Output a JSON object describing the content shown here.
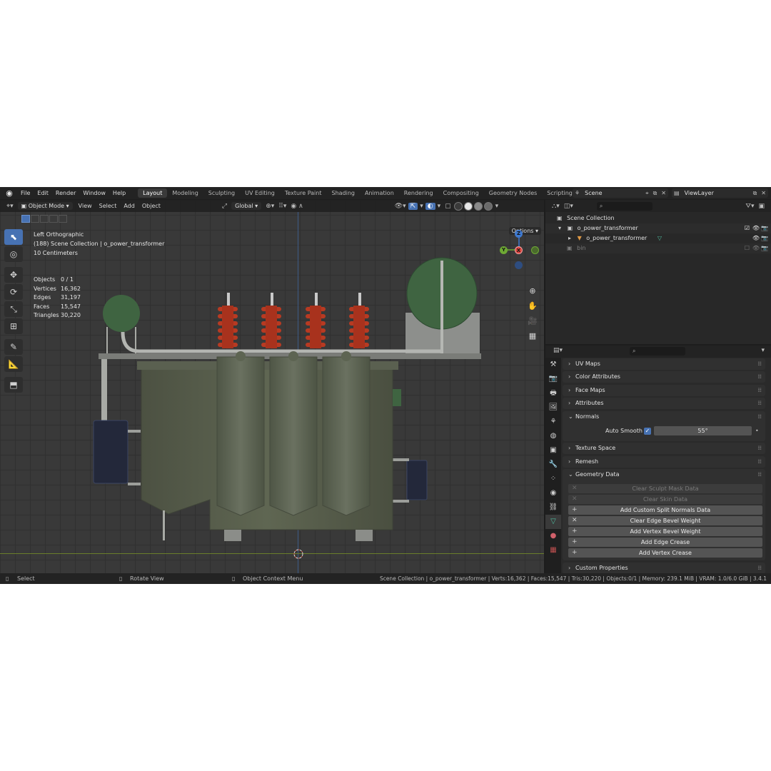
{
  "topbar": {
    "menus": [
      "File",
      "Edit",
      "Render",
      "Window",
      "Help"
    ],
    "workspace_tabs": [
      "Layout",
      "Modeling",
      "Sculpting",
      "UV Editing",
      "Texture Paint",
      "Shading",
      "Animation",
      "Rendering",
      "Compositing",
      "Geometry Nodes",
      "Scripting"
    ],
    "active_tab": "Layout",
    "add_tab": "+",
    "scene": "Scene",
    "view_layer": "ViewLayer"
  },
  "viewport": {
    "mode": "Object Mode",
    "menus": [
      "View",
      "Select",
      "Add",
      "Object"
    ],
    "transform_orientation": "Global",
    "options_label": "Options",
    "view_name": "Left Orthographic",
    "collection_line": "(188) Scene Collection | o_power_transformer",
    "scale": "10 Centimeters",
    "stats": [
      {
        "label": "Objects",
        "value": "0 / 1"
      },
      {
        "label": "Vertices",
        "value": "16,362"
      },
      {
        "label": "Edges",
        "value": "31,197"
      },
      {
        "label": "Faces",
        "value": "15,547"
      },
      {
        "label": "Triangles",
        "value": "30,220"
      }
    ],
    "gizmo_axes": {
      "z": "Z",
      "y": "Y",
      "x": "X"
    },
    "colors": {
      "x_axis": "#d8453f",
      "y_axis": "#6ea934",
      "z_axis": "#3f79cf",
      "select_blue": "#4772b3"
    }
  },
  "outliner": {
    "root": "Scene Collection",
    "items": [
      {
        "name": "o_power_transformer",
        "type": "collection"
      },
      {
        "name": "o_power_transformer",
        "type": "object"
      },
      {
        "name": "bin",
        "type": "collection"
      }
    ]
  },
  "properties": {
    "panels_top": [
      "UV Maps",
      "Color Attributes",
      "Face Maps",
      "Attributes"
    ],
    "normals": {
      "title": "Normals",
      "auto_smooth_label": "Auto Smooth",
      "auto_smooth_checked": true,
      "angle": "55°"
    },
    "panels_mid": [
      "Texture Space",
      "Remesh"
    ],
    "geometry_data": {
      "title": "Geometry Data",
      "buttons": [
        {
          "label": "Clear Sculpt Mask Data",
          "icon": "x-icon",
          "enabled": false
        },
        {
          "label": "Clear Skin Data",
          "icon": "x-icon",
          "enabled": false
        },
        {
          "label": "Add Custom Split Normals Data",
          "icon": "plus-icon",
          "enabled": true
        },
        {
          "label": "Clear Edge Bevel Weight",
          "icon": "x-icon",
          "enabled": true
        },
        {
          "label": "Add Vertex Bevel Weight",
          "icon": "plus-icon",
          "enabled": true
        },
        {
          "label": "Add Edge Crease",
          "icon": "plus-icon",
          "enabled": true
        },
        {
          "label": "Add Vertex Crease",
          "icon": "plus-icon",
          "enabled": true
        }
      ]
    },
    "panels_bottom": [
      "Custom Properties"
    ]
  },
  "statusbar": {
    "left": "Select",
    "middle": "Rotate View",
    "right": "Object Context Menu",
    "info": "Scene Collection | o_power_transformer | Verts:16,362 | Faces:15,547 | Tris:30,220 | Objects:0/1 | Memory: 239.1 MiB | VRAM: 1.0/6.0 GiB | 3.4.1"
  }
}
